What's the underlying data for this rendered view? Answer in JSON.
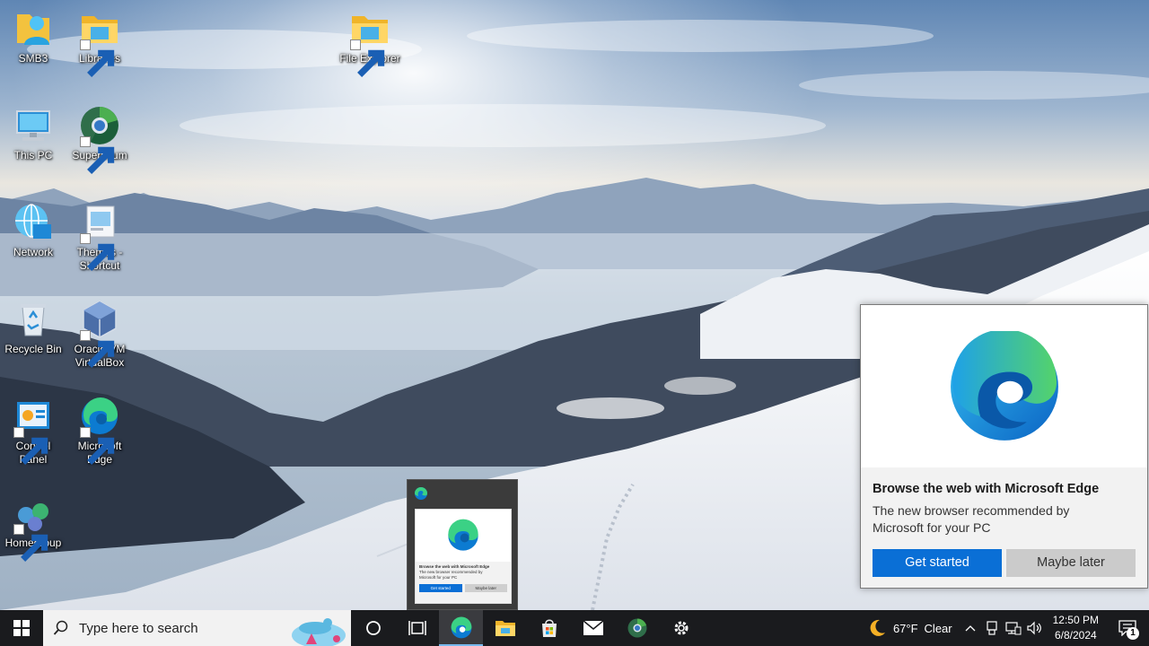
{
  "desktop": {
    "icons": {
      "smb3": "SMB3",
      "libraries": "Libraries",
      "file_explorer": "File Explorer",
      "this_pc": "This PC",
      "supermium": "Supermium",
      "network": "Network",
      "themes_1": "Themes -",
      "themes_2": "Shortcut",
      "recycle_bin": "Recycle Bin",
      "virtualbox_1": "Oracle VM",
      "virtualbox_2": "VirtualBox",
      "control_panel_1": "Control",
      "control_panel_2": "Panel",
      "edge_1": "Microsoft",
      "edge_2": "Edge",
      "homegroup": "Homegroup"
    }
  },
  "popup": {
    "title": "Browse the web with Microsoft Edge",
    "body": "The new browser recommended by Microsoft for your PC",
    "primary_button": "Get started",
    "secondary_button": "Maybe later"
  },
  "thumbnail": {
    "title": "Browse the web with Microsoft Edge",
    "body": "The new browser recommended by Microsoft for your PC",
    "primary_button": "Get started",
    "secondary_button": "Maybe later"
  },
  "taskbar": {
    "search_placeholder": "Type here to search",
    "pinned": [
      "cortana-icon",
      "task-view-icon",
      "edge-icon",
      "file-explorer-icon",
      "store-icon",
      "mail-icon",
      "supermium-icon",
      "settings-icon"
    ],
    "weather": {
      "temp": "67°F",
      "condition": "Clear"
    },
    "clock": {
      "time": "12:50 PM",
      "date": "6/8/2024"
    },
    "notification_count": "1"
  },
  "colors": {
    "accent": "#0a6fd6",
    "taskbar": "#1a1b1e",
    "secondary_button": "#cbcbcb"
  }
}
